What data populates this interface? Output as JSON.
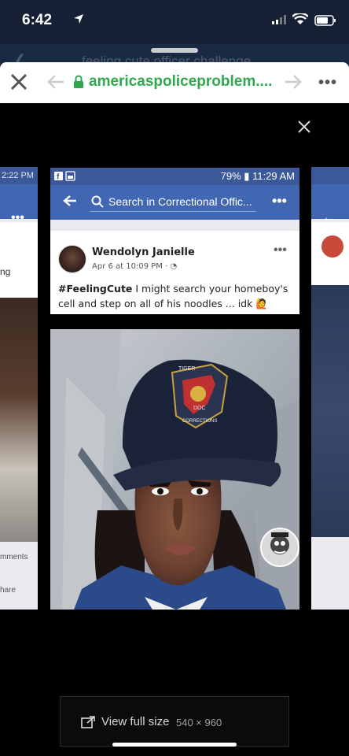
{
  "status_bar": {
    "time": "6:42"
  },
  "background_app": {
    "title": "feeling cute officer challenge"
  },
  "browser": {
    "url": "americaspoliceproblem...."
  },
  "side_left": {
    "time": "2:22 PM",
    "text": "ng",
    "comments": "mments",
    "share": "hare"
  },
  "screenshot": {
    "status_right": "79% ▮ 11:29 AM",
    "search_placeholder": "Search in Correctional Offic...",
    "post": {
      "author": "Wendolyn Janielle",
      "time": "Apr 6 at 10:09 PM · ",
      "hashtag": "#FeelingCute",
      "body": " I might search your homeboy's cell and step on all of his noodles ... idk"
    },
    "cap_text": [
      "TIGER",
      "DOC",
      "CORRECTIONS"
    ]
  },
  "view_full": {
    "label": "View full size",
    "size": "540 × 960"
  },
  "colors": {
    "fb_blue": "#3b5998",
    "fb_nav": "#4267b2",
    "url_green": "#2fa84f"
  }
}
